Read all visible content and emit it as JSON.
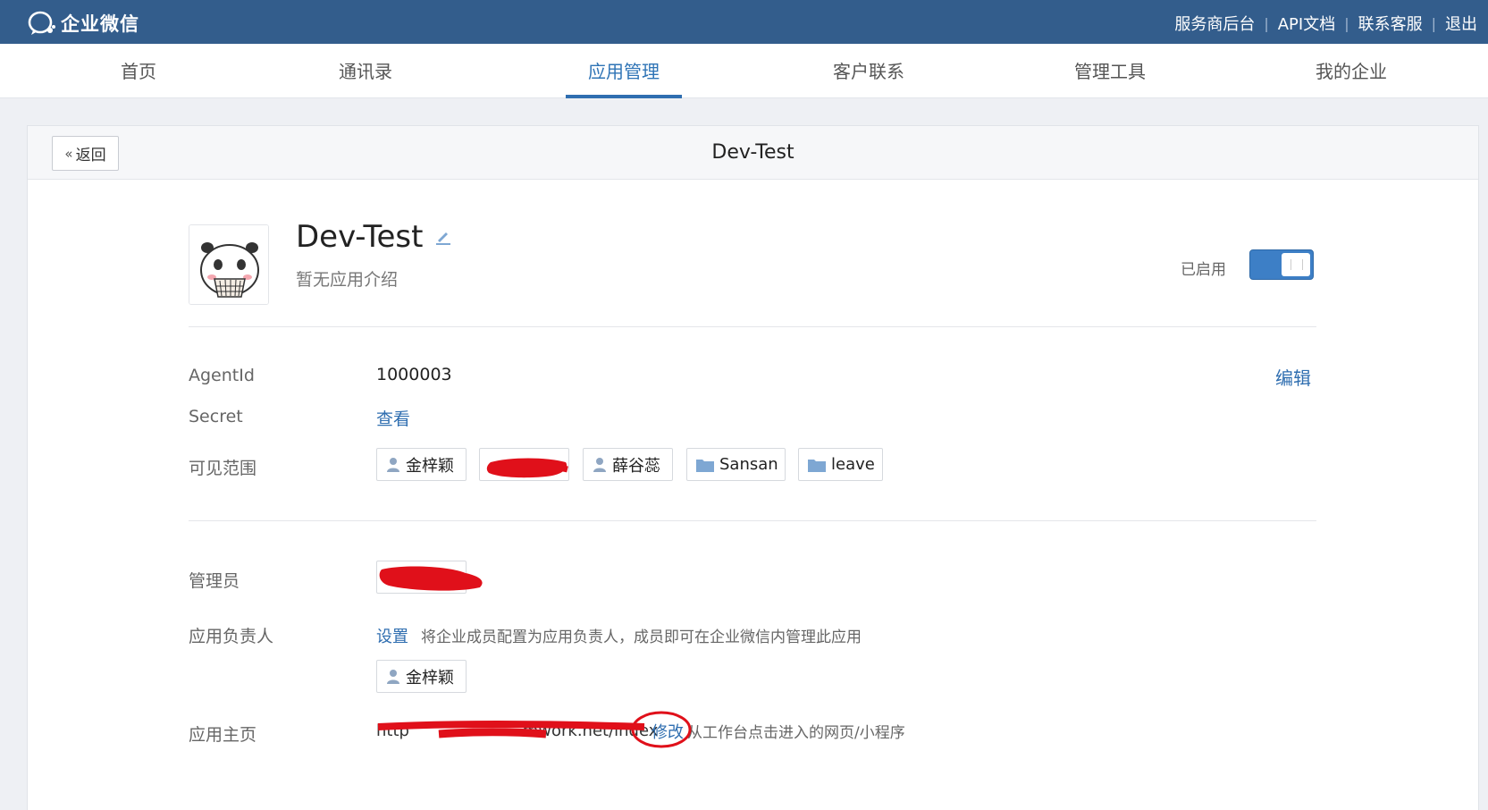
{
  "topbar": {
    "logo_text": "企业微信",
    "links": [
      "服务商后台",
      "API文档",
      "联系客服",
      "退出"
    ]
  },
  "nav": {
    "items": [
      "首页",
      "通讯录",
      "应用管理",
      "客户联系",
      "管理工具",
      "我的企业"
    ],
    "active": "应用管理"
  },
  "header": {
    "back_label": "返回",
    "title": "Dev-Test"
  },
  "app": {
    "name": "Dev-Test",
    "description": "暂无应用介绍",
    "status_label": "已启用",
    "enabled": true
  },
  "details": {
    "agentid_label": "AgentId",
    "agentid_value": "1000003",
    "edit_label": "编辑",
    "secret_label": "Secret",
    "secret_action": "查看",
    "scope_label": "可见范围",
    "scope_tags": [
      {
        "type": "user",
        "name": "金梓颖"
      },
      {
        "type": "user",
        "name": "",
        "redacted": true
      },
      {
        "type": "user",
        "name": "薛谷蕊"
      },
      {
        "type": "department",
        "name": "Sansan"
      },
      {
        "type": "department",
        "name": "leave"
      }
    ]
  },
  "admin": {
    "admin_label": "管理员",
    "owner_label": "应用负责人",
    "owner_action": "设置",
    "owner_hint": "将企业成员配置为应用负责人，成员即可在企业微信内管理此应用",
    "owner_tag": "金梓颖",
    "homepage_label": "应用主页",
    "homepage_url_start": "http",
    "homepage_url_end": ".mwork.net/index",
    "homepage_action": "修改",
    "homepage_hint": "从工作台点击进入的网页/小程序"
  },
  "colors": {
    "topbar": "#335d8c",
    "accent": "#2f6eb0",
    "redaction": "#e0101a"
  }
}
